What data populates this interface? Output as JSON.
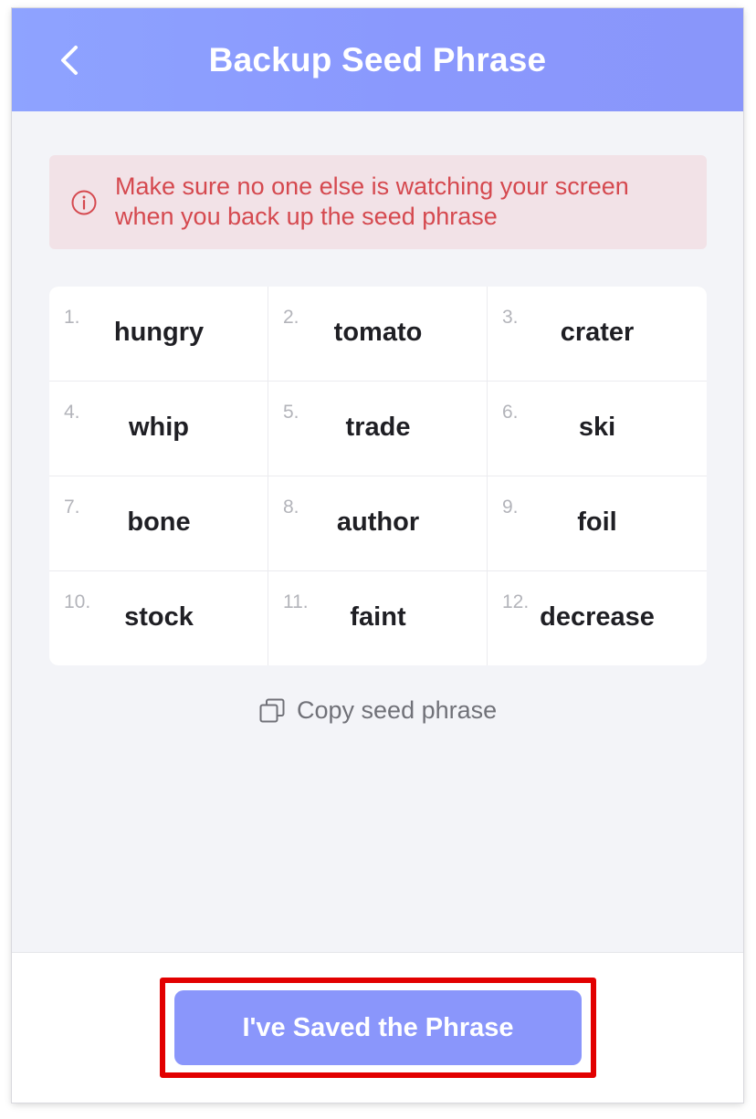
{
  "header": {
    "title": "Backup Seed Phrase",
    "back_icon": "chevron-left-icon"
  },
  "warning": {
    "icon": "info-icon",
    "text": "Make sure no one else is watching your screen when you back up the seed phrase",
    "color": "#d5494f",
    "background": "#f2e2e7"
  },
  "seed_phrase": {
    "words": [
      {
        "num": "1.",
        "word": "hungry"
      },
      {
        "num": "2.",
        "word": "tomato"
      },
      {
        "num": "3.",
        "word": "crater"
      },
      {
        "num": "4.",
        "word": "whip"
      },
      {
        "num": "5.",
        "word": "trade"
      },
      {
        "num": "6.",
        "word": "ski"
      },
      {
        "num": "7.",
        "word": "bone"
      },
      {
        "num": "8.",
        "word": "author"
      },
      {
        "num": "9.",
        "word": "foil"
      },
      {
        "num": "10.",
        "word": "stock"
      },
      {
        "num": "11.",
        "word": "faint"
      },
      {
        "num": "12.",
        "word": "decrease"
      }
    ]
  },
  "copy": {
    "icon": "copy-icon",
    "label": "Copy seed phrase"
  },
  "footer": {
    "primary_button_label": "I've Saved the Phrase"
  },
  "colors": {
    "accent": "#8a96fb",
    "highlight_border": "#e20000"
  }
}
